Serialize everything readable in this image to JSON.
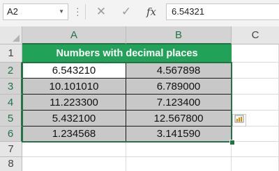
{
  "formula_bar": {
    "name_box": "A2",
    "formula": "6.54321",
    "cancel_glyph": "✕",
    "enter_glyph": "✓",
    "fx_label": "fx"
  },
  "columns": [
    "A",
    "B",
    "C"
  ],
  "rows": [
    "1",
    "2",
    "3",
    "4",
    "5",
    "6",
    "7",
    "8"
  ],
  "sheet": {
    "title": "Numbers with decimal places",
    "data": [
      [
        "6.543210",
        "4.567898"
      ],
      [
        "10.101010",
        "6.789000"
      ],
      [
        "11.223300",
        "7.123400"
      ],
      [
        "5.432100",
        "12.567800"
      ],
      [
        "1.234568",
        "3.141590"
      ]
    ]
  },
  "colors": {
    "title_fill": "#22a158",
    "data_fill": "#c8c8c8",
    "selection": "#217346"
  },
  "icons": {
    "quick_analysis": "quick-analysis-icon"
  }
}
